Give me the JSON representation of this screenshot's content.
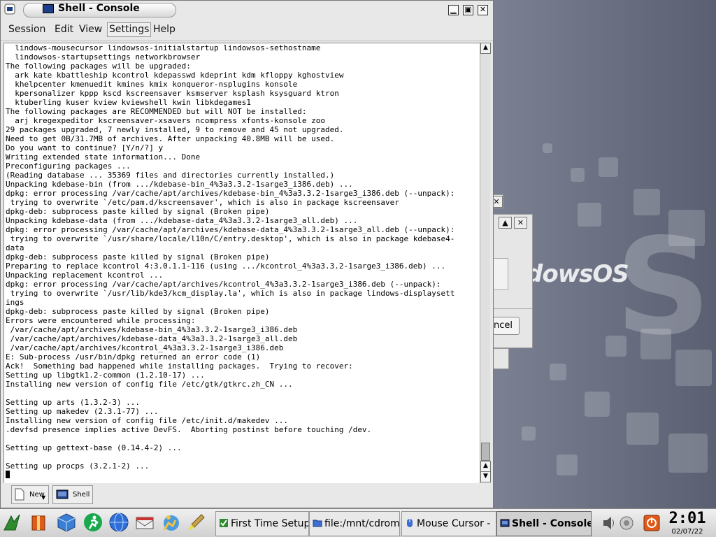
{
  "window": {
    "title": "Shell - Console"
  },
  "menu": [
    "Session",
    "Edit",
    "View",
    "Settings",
    "Help"
  ],
  "terminal": {
    "lines": [
      "  lindows-mousecursor lindowsos-initialstartup lindowsos-sethostname",
      "  lindowsos-startupsettings networkbrowser",
      "The following packages will be upgraded:",
      "  ark kate kbattleship kcontrol kdepasswd kdeprint kdm kfloppy kghostview",
      "  khelpcenter kmenuedit kmines kmix konqueror-nsplugins konsole",
      "  kpersonalizer kppp kscd kscreensaver ksmserver ksplash ksysguard ktron",
      "  ktuberling kuser kview kviewshell kwin libkdegames1",
      "The following packages are RECOMMENDED but will NOT be installed:",
      "  arj kregexpeditor kscreensaver-xsavers ncompress xfonts-konsole zoo",
      "29 packages upgraded, 7 newly installed, 9 to remove and 45 not upgraded.",
      "Need to get 0B/31.7MB of archives. After unpacking 40.8MB will be used.",
      "Do you want to continue? [Y/n/?] y",
      "Writing extended state information... Done",
      "Preconfiguring packages ...",
      "(Reading database ... 35369 files and directories currently installed.)",
      "Unpacking kdebase-bin (from .../kdebase-bin_4%3a3.3.2-1sarge3_i386.deb) ...",
      "dpkg: error processing /var/cache/apt/archives/kdebase-bin_4%3a3.3.2-1sarge3_i386.deb (--unpack):",
      " trying to overwrite `/etc/pam.d/kscreensaver', which is also in package kscreensaver",
      "dpkg-deb: subprocess paste killed by signal (Broken pipe)",
      "Unpacking kdebase-data (from .../kdebase-data_4%3a3.3.2-1sarge3_all.deb) ...",
      "dpkg: error processing /var/cache/apt/archives/kdebase-data_4%3a3.3.2-1sarge3_all.deb (--unpack):",
      " trying to overwrite `/usr/share/locale/l10n/C/entry.desktop', which is also in package kdebase4-",
      "data",
      "dpkg-deb: subprocess paste killed by signal (Broken pipe)",
      "Preparing to replace kcontrol 4:3.0.1.1-116 (using .../kcontrol_4%3a3.3.2-1sarge3_i386.deb) ...",
      "Unpacking replacement kcontrol ...",
      "dpkg: error processing /var/cache/apt/archives/kcontrol_4%3a3.3.2-1sarge3_i386.deb (--unpack):",
      " trying to overwrite `/usr/lib/kde3/kcm_display.la', which is also in package lindows-displaysett",
      "ings",
      "dpkg-deb: subprocess paste killed by signal (Broken pipe)",
      "Errors were encountered while processing:",
      " /var/cache/apt/archives/kdebase-bin_4%3a3.3.2-1sarge3_i386.deb",
      " /var/cache/apt/archives/kdebase-data_4%3a3.3.2-1sarge3_all.deb",
      " /var/cache/apt/archives/kcontrol_4%3a3.3.2-1sarge3_i386.deb",
      "E: Sub-process /usr/bin/dpkg returned an error code (1)",
      "Ack!  Something bad happened while installing packages.  Trying to recover:",
      "Setting up libgtk1.2-common (1.2.10-17) ...",
      "Installing new version of config file /etc/gtk/gtkrc.zh_CN ...",
      "",
      "Setting up arts (1.3.2-3) ...",
      "Setting up makedev (2.3.1-77) ...",
      "Installing new version of config file /etc/init.d/makedev ...",
      ".devfsd presence implies active DevFS.  Aborting postinst before touching /dev.",
      "",
      "Setting up gettext-base (0.14.4-2) ...",
      "",
      "Setting up procps (3.2.1-2) ...",
      ""
    ]
  },
  "sessions": [
    {
      "label": "New",
      "icon": "new-session-icon"
    },
    {
      "label": "Shell",
      "icon": "terminal-icon"
    }
  ],
  "background_dialog": {
    "cancel_label": "ncel"
  },
  "desktop": {
    "watermark": "dowsOS"
  },
  "taskbar": {
    "launchers": [
      "start-menu-icon",
      "life-vest-icon",
      "cube-icon",
      "running-man-icon",
      "globe-icon",
      "mail-icon",
      "click-n-run-icon",
      "paintbrush-icon"
    ],
    "tasks": [
      {
        "label": "First Time Setup",
        "icon": "setup-icon",
        "active": false
      },
      {
        "label": "file:/mnt/cdrom1",
        "icon": "folder-icon",
        "active": false
      },
      {
        "label": "Mouse Cursor -",
        "icon": "mouse-icon",
        "active": false
      },
      {
        "label": "Shell - Console",
        "icon": "terminal-icon",
        "active": true
      }
    ],
    "clock_time": "2:01",
    "clock_date": "02/07/22"
  },
  "colors": {
    "accent": "#1d3f8a",
    "error_orange": "#e05a1a"
  }
}
